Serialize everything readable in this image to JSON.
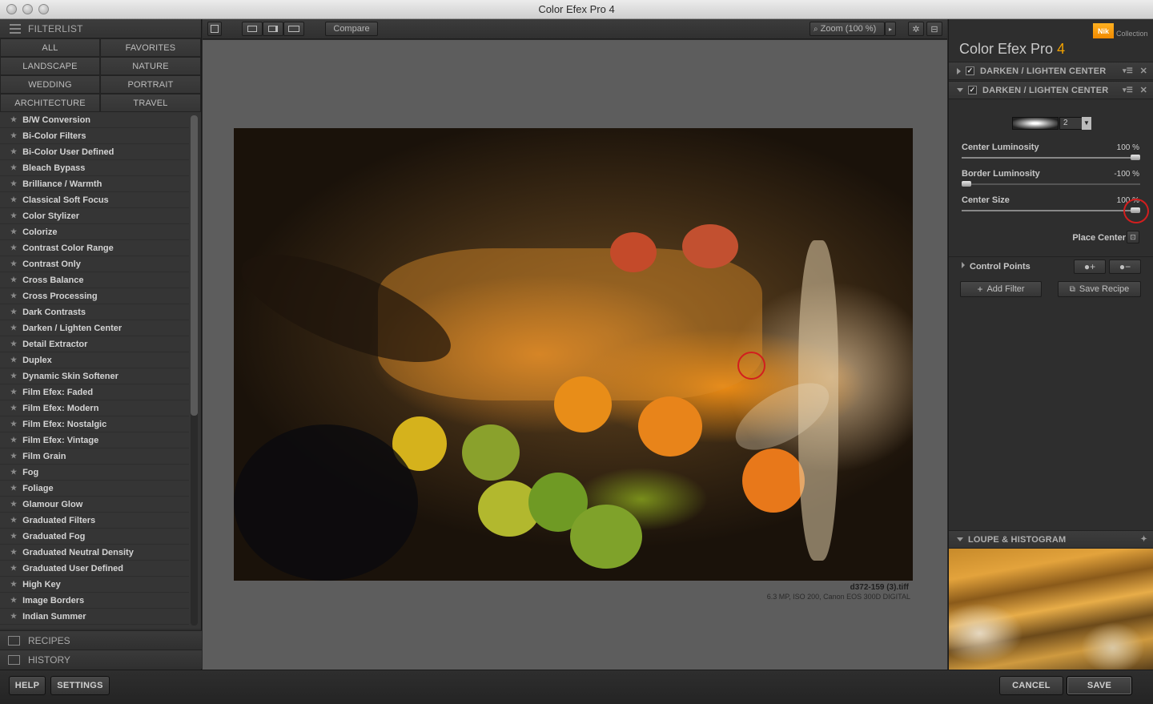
{
  "window": {
    "title": "Color Efex Pro 4"
  },
  "left_panel": {
    "filterlist_title": "FILTERLIST",
    "categories": [
      "ALL",
      "FAVORITES",
      "LANDSCAPE",
      "NATURE",
      "WEDDING",
      "PORTRAIT",
      "ARCHITECTURE",
      "TRAVEL"
    ],
    "filters": [
      "B/W Conversion",
      "Bi-Color Filters",
      "Bi-Color User Defined",
      "Bleach Bypass",
      "Brilliance / Warmth",
      "Classical Soft Focus",
      "Color Stylizer",
      "Colorize",
      "Contrast Color Range",
      "Contrast Only",
      "Cross Balance",
      "Cross Processing",
      "Dark Contrasts",
      "Darken / Lighten Center",
      "Detail Extractor",
      "Duplex",
      "Dynamic Skin Softener",
      "Film Efex: Faded",
      "Film Efex: Modern",
      "Film Efex: Nostalgic",
      "Film Efex: Vintage",
      "Film Grain",
      "Fog",
      "Foliage",
      "Glamour Glow",
      "Graduated Filters",
      "Graduated Fog",
      "Graduated Neutral Density",
      "Graduated User Defined",
      "High Key",
      "Image Borders",
      "Indian Summer"
    ],
    "recipes_label": "RECIPES",
    "history_label": "HISTORY"
  },
  "toolbar": {
    "compare_label": "Compare",
    "zoom_label": "Zoom (100 %)"
  },
  "image": {
    "filename": "d372-159 (3).tiff",
    "info": "6.3 MP, ISO 200, Canon EOS 300D DIGITAL"
  },
  "right_panel": {
    "brand_logo": "Nik",
    "brand_sub": "Collection",
    "app_title": "Color Efex Pro",
    "app_version": "4",
    "filter_stack": [
      {
        "label": "DARKEN / LIGHTEN CENTER",
        "expanded": false,
        "checked": true
      },
      {
        "label": "DARKEN / LIGHTEN CENTER",
        "expanded": true,
        "checked": true
      }
    ],
    "method_value": "2",
    "sliders": [
      {
        "label": "Center Luminosity",
        "value_text": "100 %",
        "fraction": 1.0
      },
      {
        "label": "Border Luminosity",
        "value_text": "-100 %",
        "fraction": 0.0
      },
      {
        "label": "Center Size",
        "value_text": "100 %",
        "fraction": 1.0
      }
    ],
    "place_center_label": "Place Center",
    "control_points_label": "Control Points",
    "add_filter_label": "Add Filter",
    "save_recipe_label": "Save Recipe",
    "loupe_label": "LOUPE & HISTOGRAM"
  },
  "bottom": {
    "help_label": "HELP",
    "settings_label": "SETTINGS",
    "cancel_label": "CANCEL",
    "save_label": "SAVE"
  },
  "colors": {
    "accent": "#f0a000",
    "highlight_ring": "#d21e1e"
  }
}
